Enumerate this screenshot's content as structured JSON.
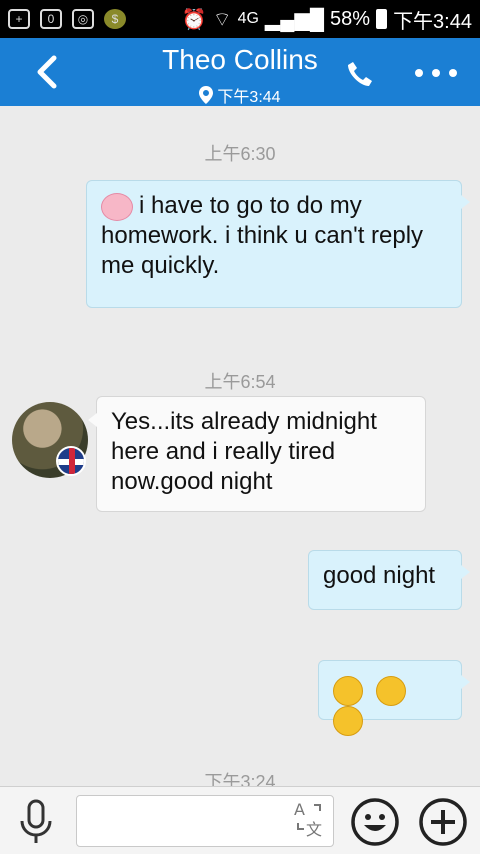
{
  "status_bar": {
    "network": "4G",
    "battery": "58%",
    "time": "下午3:44"
  },
  "header": {
    "title": "Theo Collins",
    "subtitle_time": "下午3:44"
  },
  "messages": [
    {
      "time": "上午6:30",
      "text": "i have to go to do my homework. i think u can't reply me quickly."
    },
    {
      "time": "上午6:54",
      "text": "Yes...its already midnight here and i really tired now.good night"
    },
    {
      "text": "good night"
    },
    {
      "emojis": [
        "grin",
        "kiss",
        "kiss"
      ]
    },
    {
      "time": "下午3:24"
    }
  ],
  "input": {
    "placeholder": ""
  },
  "icons": {
    "back": "back-arrow-icon",
    "phone": "phone-icon",
    "more": "more-icon",
    "mic": "mic-icon",
    "translate": "translate-icon",
    "emoji": "emoji-icon",
    "plus": "plus-icon"
  },
  "colors": {
    "header": "#1b7fd4",
    "outgoing_bubble": "#d9f2fc",
    "incoming_bubble": "#fafafa",
    "background": "#ebebeb"
  }
}
